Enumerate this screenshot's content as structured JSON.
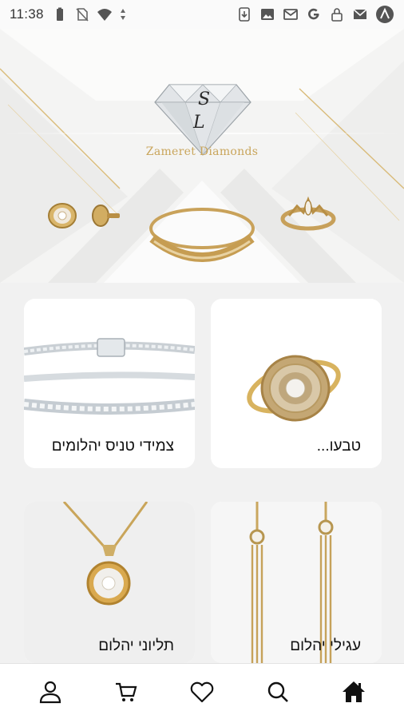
{
  "status_bar": {
    "time": "11:38",
    "left_icons": [
      "battery-saver-icon",
      "no-sim-icon",
      "wifi-icon",
      "data-arrows-icon"
    ],
    "right_icons": [
      "download-icon",
      "image-icon",
      "gmail-icon",
      "google-icon",
      "lock-icon",
      "mail-icon",
      "app-badge-icon"
    ]
  },
  "hero": {
    "logo_letters": "SL",
    "brand_name": "Zameret Diamonds"
  },
  "products": [
    {
      "id": "rings",
      "label": "טבעו..."
    },
    {
      "id": "tennis",
      "label": "צמידי טניס יהלומים"
    },
    {
      "id": "earrings",
      "label": "עגילי יהלום"
    },
    {
      "id": "pendants",
      "label": "תליוני יהלום"
    }
  ],
  "bottom_nav": [
    "profile-icon",
    "cart-icon",
    "heart-icon",
    "search-icon",
    "home-icon"
  ],
  "colors": {
    "gold": "#c9a55b",
    "accent": "#111111"
  }
}
